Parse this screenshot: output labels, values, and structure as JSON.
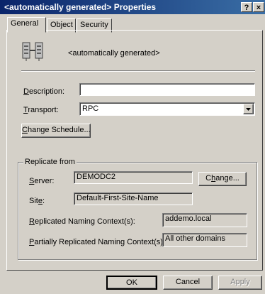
{
  "window": {
    "title": "<automatically generated> Properties",
    "help_label": "?",
    "close_label": "×"
  },
  "tabs": [
    {
      "label": "General"
    },
    {
      "label": "Object"
    },
    {
      "label": "Security"
    }
  ],
  "object_name": "<automatically generated>",
  "description": {
    "label": "Description:",
    "mnemonic": "D",
    "rest": "escription:",
    "value": ""
  },
  "transport": {
    "mnemonic": "T",
    "rest": "ransport:",
    "value": "RPC"
  },
  "change_schedule": {
    "mnemonic": "C",
    "rest": "hange Schedule..."
  },
  "replicate_from": {
    "label": "Replicate from",
    "server": {
      "mnemonic": "S",
      "rest": "erver:",
      "value": "DEMODC2"
    },
    "change_button": {
      "pre": "C",
      "mnemonic": "h",
      "rest": "ange..."
    },
    "site": {
      "pre": "Sit",
      "mnemonic": "e",
      "rest": ":",
      "value": "Default-First-Site-Name"
    },
    "naming_context": {
      "mnemonic": "R",
      "rest": "eplicated Naming Context(s):",
      "value": "addemo.local"
    },
    "partial_context": {
      "mnemonic": "P",
      "rest": "artially Replicated Naming Context(s):",
      "value": "All other domains"
    }
  },
  "buttons": {
    "ok": "OK",
    "cancel": "Cancel",
    "apply": "Apply"
  },
  "colors": {
    "titlebar_start": "#0a246a",
    "titlebar_end": "#3a6ea5",
    "face": "#d4d0c8"
  }
}
